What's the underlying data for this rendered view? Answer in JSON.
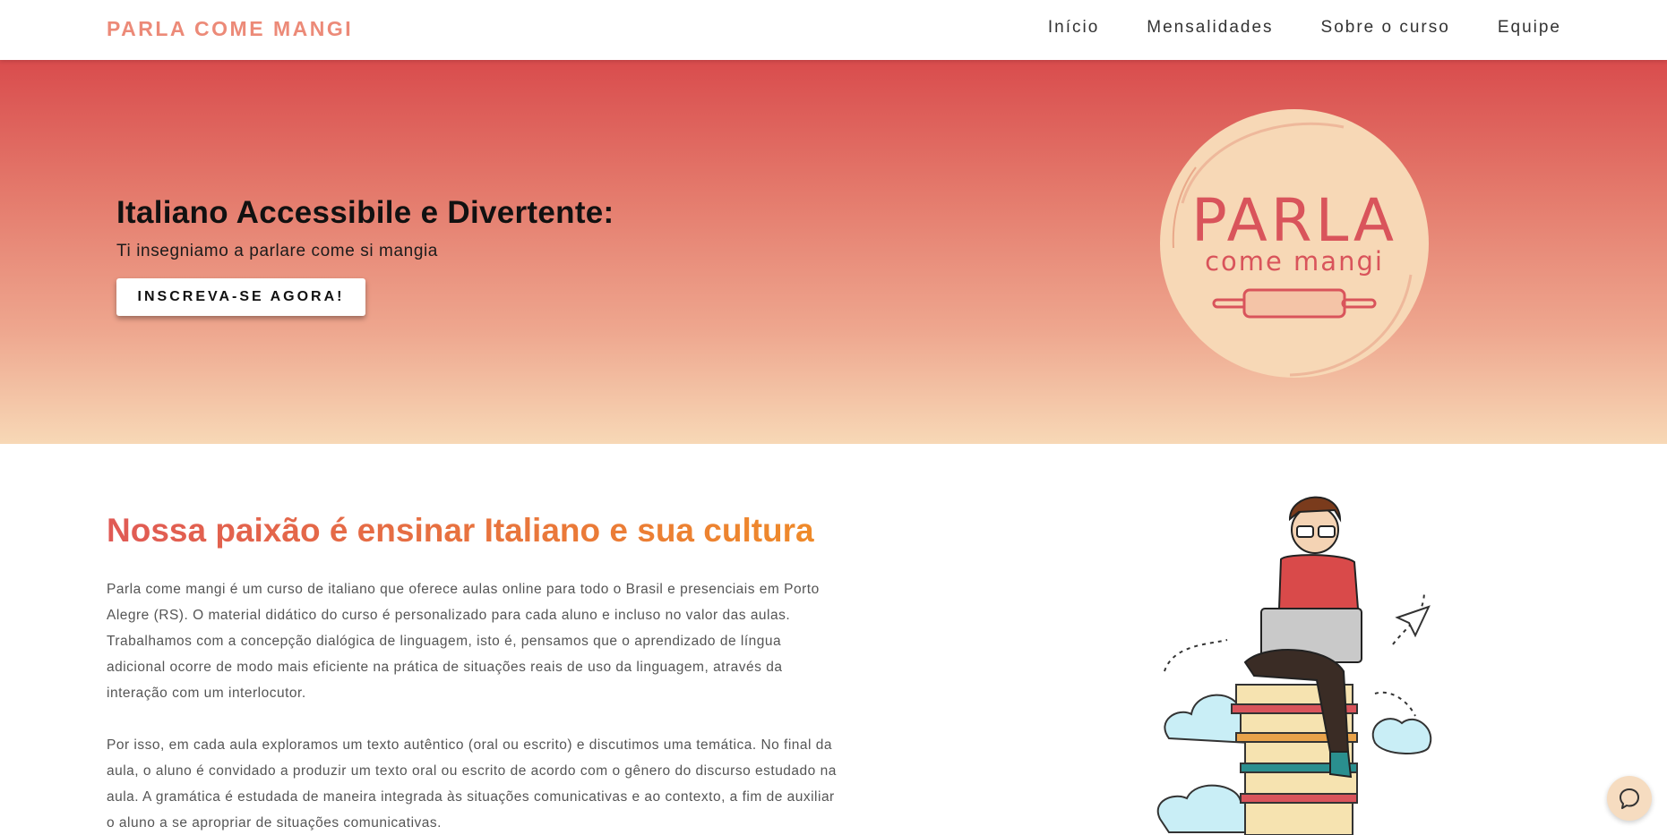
{
  "header": {
    "brand": "PARLA COME MANGI",
    "nav": [
      "Início",
      "Mensalidades",
      "Sobre o curso",
      "Equipe"
    ]
  },
  "hero": {
    "title": "Italiano Accessibile e Divertente:",
    "subtitle": "Ti insegniamo a parlare come si mangia",
    "cta": "INSCREVA-SE AGORA!",
    "logo_text_main": "PARLA",
    "logo_text_sub": "come mangi"
  },
  "about": {
    "heading": "Nossa paixão é ensinar Italiano e sua cultura",
    "paragraphs": [
      "Parla come mangi é um curso de italiano que oferece aulas online para todo o Brasil e presenciais em Porto Alegre (RS). O material didático do curso é personalizado para cada aluno e incluso no valor das aulas. Trabalhamos com a concepção dialógica de linguagem, isto é, pensamos que o aprendizado de língua adicional ocorre de modo mais eficiente na prática de situações reais de uso da linguagem, através da interação com um interlocutor.",
      "Por isso, em cada aula exploramos um texto autêntico (oral ou escrito) e discutimos uma temática. No final da aula, o aluno é convidado a produzir um texto oral ou escrito de acordo com o gênero do discurso estudado na aula. A gramática é estudada de maneira integrada às situações comunicativas e ao contexto, a fim de auxiliar o aluno a se apropriar de situações comunicativas."
    ]
  },
  "icons": {
    "chat": "chat-bubble-icon",
    "logo": "parla-come-mangi-logo",
    "illustration": "student-on-books-illustration"
  },
  "colors": {
    "brand": "#ec8a78",
    "hero_top": "#d94c4d",
    "hero_bottom": "#f7d8b6",
    "heading_start": "#e05a55",
    "heading_end": "#ef8a2a",
    "logo_red": "#d9545b",
    "logo_bg": "#f7d8b6"
  }
}
